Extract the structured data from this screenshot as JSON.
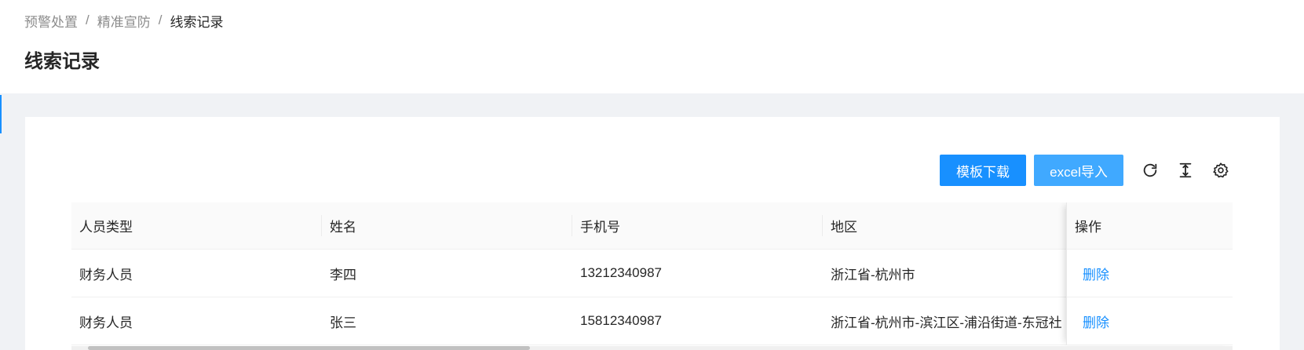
{
  "breadcrumb": {
    "items": [
      "预警处置",
      "精准宣防",
      "线索记录"
    ],
    "separator": "/"
  },
  "page": {
    "title": "线索记录"
  },
  "toolbar": {
    "template_download_label": "模板下载",
    "excel_import_label": "excel导入",
    "icons": [
      "reload-icon",
      "column-height-icon",
      "setting-icon"
    ]
  },
  "table": {
    "columns": [
      "人员类型",
      "姓名",
      "手机号",
      "地区",
      "操作"
    ],
    "rows": [
      {
        "type": "财务人员",
        "name": "李四",
        "phone": "13212340987",
        "region": "浙江省-杭州市",
        "action": "删除"
      },
      {
        "type": "财务人员",
        "name": "张三",
        "phone": "15812340987",
        "region": "浙江省-杭州市-滨江区-浦沿街道-东冠社",
        "action": "删除"
      }
    ]
  },
  "colors": {
    "primary": "#1890ff",
    "primary_light": "#40a9ff",
    "link": "#1890ff"
  }
}
